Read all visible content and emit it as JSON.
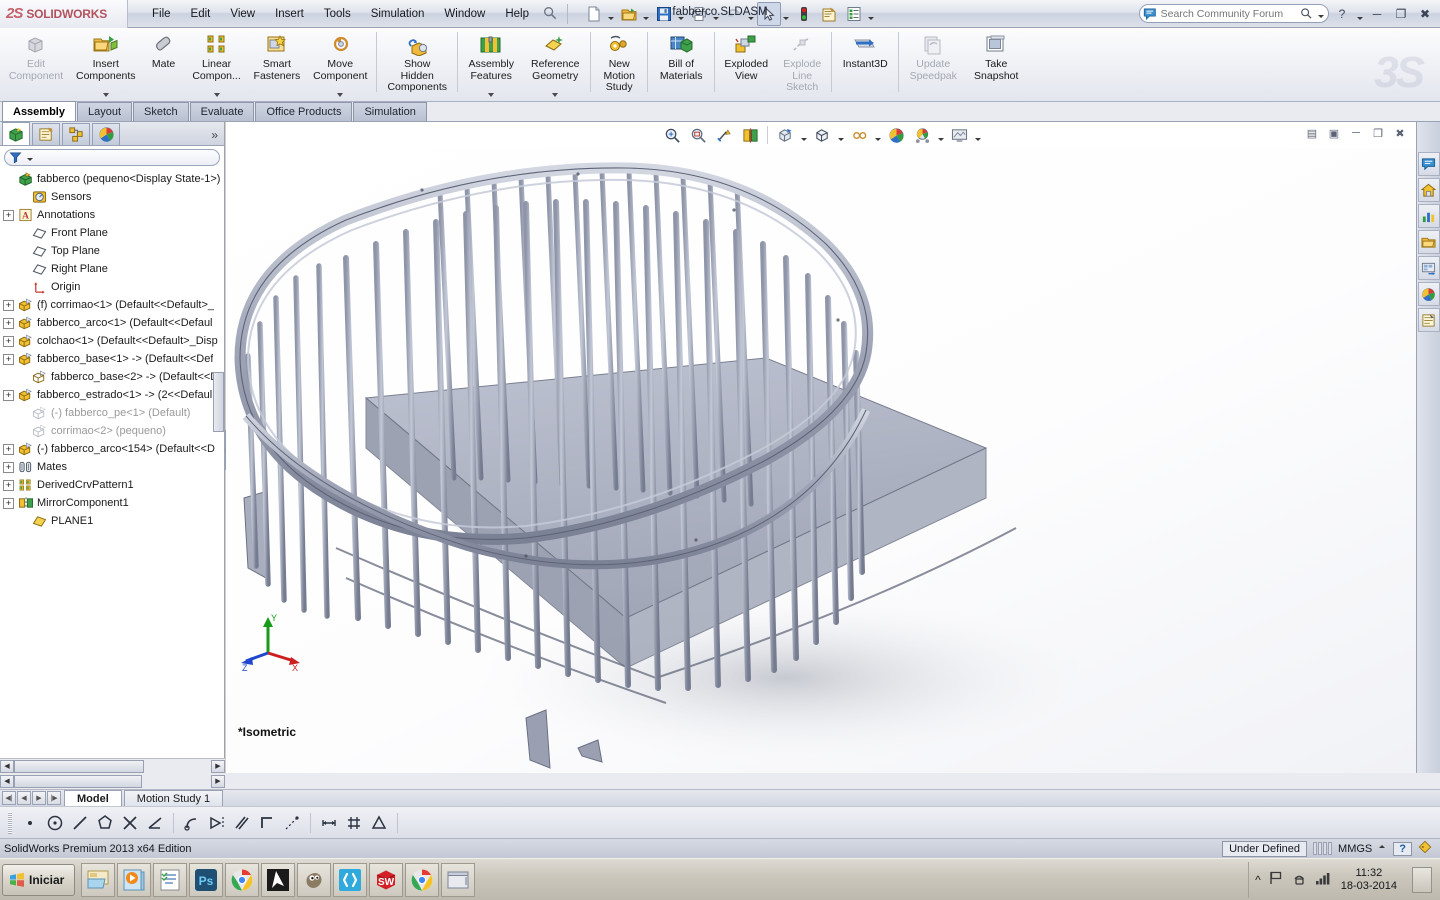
{
  "titlebar": {
    "brand_ds": "2S",
    "brand_name": "SOLIDWORKS",
    "document_title": "fabberco.SLDASM",
    "menus": [
      "File",
      "Edit",
      "View",
      "Insert",
      "Tools",
      "Simulation",
      "Window",
      "Help"
    ],
    "quick_tools": [
      {
        "name": "new-document-icon",
        "label": "New"
      },
      {
        "name": "open-document-icon",
        "label": "Open"
      },
      {
        "name": "save-icon",
        "label": "Save"
      },
      {
        "name": "print-icon",
        "label": "Print"
      },
      {
        "name": "undo-icon",
        "label": "Undo"
      },
      {
        "name": "select-arrow-icon",
        "label": "Select"
      },
      {
        "name": "rebuild-icon",
        "label": "Rebuild"
      },
      {
        "name": "file-properties-icon",
        "label": "File Properties"
      },
      {
        "name": "options-icon",
        "label": "Options"
      }
    ],
    "search": {
      "placeholder": "Search Community Forum",
      "value": ""
    },
    "window_buttons": [
      "help",
      "minimize",
      "restore",
      "close"
    ]
  },
  "ribbon": {
    "watermark": "3S",
    "commands": [
      {
        "label": "Edit\nComponent",
        "icon": "edit-component-icon",
        "disabled": true,
        "dropdown": false
      },
      {
        "label": "Insert\nComponents",
        "icon": "insert-components-icon",
        "disabled": false,
        "dropdown": true
      },
      {
        "label": "Mate",
        "icon": "mate-icon",
        "disabled": false,
        "dropdown": false
      },
      {
        "label": "Linear\nCompon...",
        "icon": "linear-component-pattern-icon",
        "disabled": false,
        "dropdown": true
      },
      {
        "label": "Smart\nFasteners",
        "icon": "smart-fasteners-icon",
        "disabled": false,
        "dropdown": false
      },
      {
        "label": "Move\nComponent",
        "icon": "move-component-icon",
        "disabled": false,
        "dropdown": true
      },
      {
        "label": "Show\nHidden\nComponents",
        "icon": "show-hidden-components-icon",
        "disabled": false,
        "dropdown": false
      },
      {
        "label": "Assembly\nFeatures",
        "icon": "assembly-features-icon",
        "disabled": false,
        "dropdown": true
      },
      {
        "label": "Reference\nGeometry",
        "icon": "reference-geometry-icon",
        "disabled": false,
        "dropdown": true
      },
      {
        "label": "New\nMotion\nStudy",
        "icon": "new-motion-study-icon",
        "disabled": false,
        "dropdown": false
      },
      {
        "label": "Bill of\nMaterials",
        "icon": "bill-of-materials-icon",
        "disabled": false,
        "dropdown": false
      },
      {
        "label": "Exploded\nView",
        "icon": "exploded-view-icon",
        "disabled": false,
        "dropdown": false
      },
      {
        "label": "Explode\nLine\nSketch",
        "icon": "explode-line-sketch-icon",
        "disabled": true,
        "dropdown": false
      },
      {
        "label": "Instant3D",
        "icon": "instant3d-icon",
        "disabled": false,
        "dropdown": false
      },
      {
        "label": "Update\nSpeedpak",
        "icon": "update-speedpak-icon",
        "disabled": true,
        "dropdown": false
      },
      {
        "label": "Take\nSnapshot",
        "icon": "take-snapshot-icon",
        "disabled": false,
        "dropdown": false
      }
    ]
  },
  "command_tabs": {
    "items": [
      "Assembly",
      "Layout",
      "Sketch",
      "Evaluate",
      "Office Products",
      "Simulation"
    ],
    "active": "Assembly"
  },
  "left_panel": {
    "tabs": [
      {
        "name": "feature-manager-tab",
        "active": true
      },
      {
        "name": "property-manager-tab",
        "active": false
      },
      {
        "name": "configuration-manager-tab",
        "active": false
      },
      {
        "name": "display-manager-tab",
        "active": false
      }
    ],
    "more_glyph": "»",
    "filter": {
      "placeholder": "",
      "value": ""
    },
    "tree": [
      {
        "label": "fabberco  (pequeno<Display State-1>)",
        "icon": "assembly-icon",
        "indent": 0,
        "toggle": "none",
        "dim": false
      },
      {
        "label": "Sensors",
        "icon": "sensors-icon",
        "indent": 1,
        "toggle": "none",
        "dim": false
      },
      {
        "label": "Annotations",
        "icon": "annotations-icon",
        "indent": 1,
        "toggle": "plus",
        "dim": false
      },
      {
        "label": "Front Plane",
        "icon": "plane-icon",
        "indent": 1,
        "toggle": "none",
        "dim": false
      },
      {
        "label": "Top Plane",
        "icon": "plane-icon",
        "indent": 1,
        "toggle": "none",
        "dim": false
      },
      {
        "label": "Right Plane",
        "icon": "plane-icon",
        "indent": 1,
        "toggle": "none",
        "dim": false
      },
      {
        "label": "Origin",
        "icon": "origin-icon",
        "indent": 1,
        "toggle": "none",
        "dim": false
      },
      {
        "label": "(f) corrimao<1> (Default<<Default>_",
        "icon": "component-icon",
        "indent": 1,
        "toggle": "plus",
        "dim": false
      },
      {
        "label": "fabberco_arco<1> (Default<<Defaul",
        "icon": "component-icon",
        "indent": 1,
        "toggle": "plus",
        "dim": false
      },
      {
        "label": "colchao<1> (Default<<Default>_Disp",
        "icon": "component-icon",
        "indent": 1,
        "toggle": "plus",
        "dim": false
      },
      {
        "label": "fabberco_base<1> -> (Default<<Def",
        "icon": "component-icon",
        "indent": 1,
        "toggle": "plus",
        "dim": false
      },
      {
        "label": "fabberco_base<2> -> (Default<<Def",
        "icon": "component-hidden-icon",
        "indent": 1,
        "toggle": "none",
        "dim": false
      },
      {
        "label": "fabberco_estrado<1> -> (2<<Defaul",
        "icon": "component-icon",
        "indent": 1,
        "toggle": "plus",
        "dim": false
      },
      {
        "label": "(-) fabberco_pe<1> (Default)",
        "icon": "component-suppressed-icon",
        "indent": 1,
        "toggle": "none",
        "dim": true
      },
      {
        "label": "corrimao<2> (pequeno)",
        "icon": "component-suppressed-icon",
        "indent": 1,
        "toggle": "none",
        "dim": true
      },
      {
        "label": "(-) fabberco_arco<154> (Default<<D",
        "icon": "component-icon",
        "indent": 1,
        "toggle": "plus",
        "dim": false
      },
      {
        "label": "Mates",
        "icon": "mates-folder-icon",
        "indent": 1,
        "toggle": "plus",
        "dim": false
      },
      {
        "label": "DerivedCrvPattern1",
        "icon": "derived-pattern-icon",
        "indent": 1,
        "toggle": "plus",
        "dim": false
      },
      {
        "label": "MirrorComponent1",
        "icon": "mirror-component-icon",
        "indent": 1,
        "toggle": "plus",
        "dim": false
      },
      {
        "label": "PLANE1",
        "icon": "plane-icon",
        "indent": 1,
        "toggle": "none",
        "dim": false
      }
    ]
  },
  "view_toolbar": {
    "buttons": [
      {
        "name": "zoom-to-fit-icon",
        "dropdown": false
      },
      {
        "name": "zoom-to-area-icon",
        "dropdown": false
      },
      {
        "name": "previous-view-icon",
        "dropdown": false
      },
      {
        "name": "section-view-icon",
        "dropdown": false
      },
      {
        "name": "view-orientation-icon",
        "dropdown": true
      },
      {
        "name": "display-style-icon",
        "dropdown": true
      },
      {
        "name": "hide-show-items-icon",
        "dropdown": true
      },
      {
        "name": "edit-appearance-icon",
        "dropdown": false
      },
      {
        "name": "apply-scene-icon",
        "dropdown": true
      },
      {
        "name": "view-settings-icon",
        "dropdown": true
      }
    ],
    "document_buttons": [
      "tile-horizontally",
      "tile-vertically",
      "minimize-doc",
      "restore-doc",
      "close-doc"
    ]
  },
  "graphics": {
    "view_orientation_label": "*Isometric",
    "triad": {
      "x_axis": "X",
      "y_axis": "Y",
      "z_axis": "Z",
      "x_color": "#cc1f1f",
      "y_color": "#169c16",
      "z_color": "#1f46cc"
    },
    "model_name": "fabberco crib assembly",
    "model_fill": "#aab0c4",
    "model_edge": "#4c5263"
  },
  "task_pane": {
    "buttons": [
      {
        "name": "solidworks-resources-icon"
      },
      {
        "name": "design-library-icon"
      },
      {
        "name": "file-explorer-icon"
      },
      {
        "name": "search-folder-icon"
      },
      {
        "name": "view-palette-icon"
      },
      {
        "name": "appearances-scenes-icon"
      },
      {
        "name": "custom-properties-icon"
      }
    ]
  },
  "model_tabs": {
    "items": [
      "Model",
      "Motion Study 1"
    ],
    "active": "Model",
    "nav_buttons": [
      "first",
      "previous",
      "next",
      "last"
    ]
  },
  "sketch_toolbar": {
    "buttons": [
      {
        "name": "point-icon"
      },
      {
        "name": "circle-icon"
      },
      {
        "name": "line-icon"
      },
      {
        "name": "polygon-icon"
      },
      {
        "name": "trim-entities-icon"
      },
      {
        "name": "angle-icon"
      },
      {
        "name": "tangent-arc-icon"
      },
      {
        "name": "mirror-entities-icon"
      },
      {
        "name": "offset-entities-icon"
      },
      {
        "name": "corner-rectangle-icon"
      },
      {
        "name": "construction-geometry-icon"
      },
      {
        "name": "smart-dimension-icon"
      },
      {
        "name": "grid-settings-icon"
      },
      {
        "name": "add-relation-icon"
      }
    ]
  },
  "status_bar": {
    "edition": "SolidWorks Premium 2013 x64 Edition",
    "state": "Under Defined",
    "units": "MMGS",
    "help_glyph": "?",
    "tag_icon": "tag-icon"
  },
  "taskbar": {
    "start_label": "Iniciar",
    "items": [
      {
        "name": "windows-explorer-icon",
        "label": "Explorer"
      },
      {
        "name": "media-player-icon",
        "label": "Media Player"
      },
      {
        "name": "notepad-list-icon",
        "label": "Notes"
      },
      {
        "name": "photoshop-icon",
        "label": "Ps"
      },
      {
        "name": "chrome-icon",
        "label": "Chrome"
      },
      {
        "name": "inkscape-icon",
        "label": "Inkscape"
      },
      {
        "name": "gimp-icon",
        "label": "GIMP"
      },
      {
        "name": "brackets-icon",
        "label": "Brackets"
      },
      {
        "name": "solidworks-taskbar-icon",
        "label": "SW"
      },
      {
        "name": "chrome-window-icon",
        "label": "Chrome"
      },
      {
        "name": "window-icon",
        "label": "Window"
      }
    ],
    "tray": [
      {
        "name": "show-hidden-icons-icon"
      },
      {
        "name": "flag-action-center-icon"
      },
      {
        "name": "network-icon"
      },
      {
        "name": "volume-bars-icon"
      }
    ],
    "clock": {
      "time": "11:32",
      "date": "18-03-2014"
    }
  }
}
